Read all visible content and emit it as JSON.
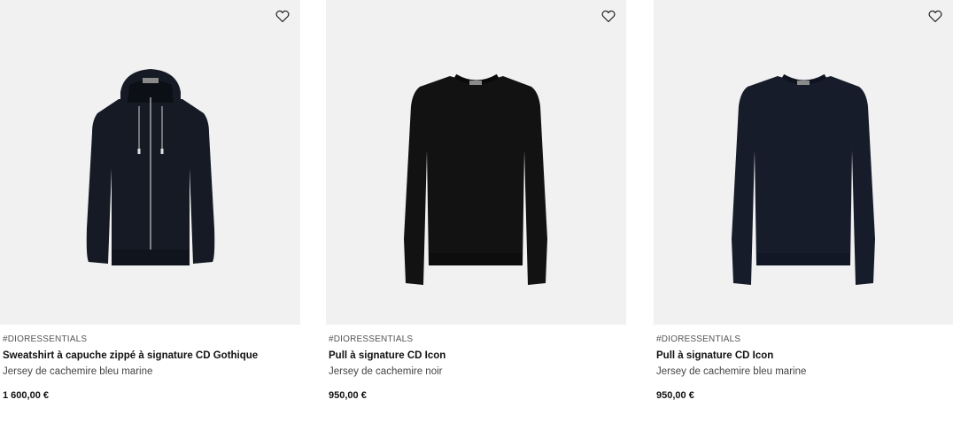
{
  "products": [
    {
      "tag": "#DIORESSENTIALS",
      "name": "Sweatshirt à capuche zippé à signature CD Gothique",
      "material": "Jersey de cachemire bleu marine",
      "price": "1 600,00 €",
      "favorite_icon": "heart-outline-icon",
      "garment_color": "#151a25"
    },
    {
      "tag": "#DIORESSENTIALS",
      "name": "Pull à signature CD Icon",
      "material": "Jersey de cachemire noir",
      "price": "950,00 €",
      "favorite_icon": "heart-outline-icon",
      "garment_color": "#121212"
    },
    {
      "tag": "#DIORESSENTIALS",
      "name": "Pull à signature CD Icon",
      "material": "Jersey de cachemire bleu marine",
      "price": "950,00 €",
      "favorite_icon": "heart-outline-icon",
      "garment_color": "#171c2b"
    }
  ],
  "colors": {
    "image_background": "#f1f1f1",
    "text": "#111111",
    "secondary_text": "#555555"
  }
}
